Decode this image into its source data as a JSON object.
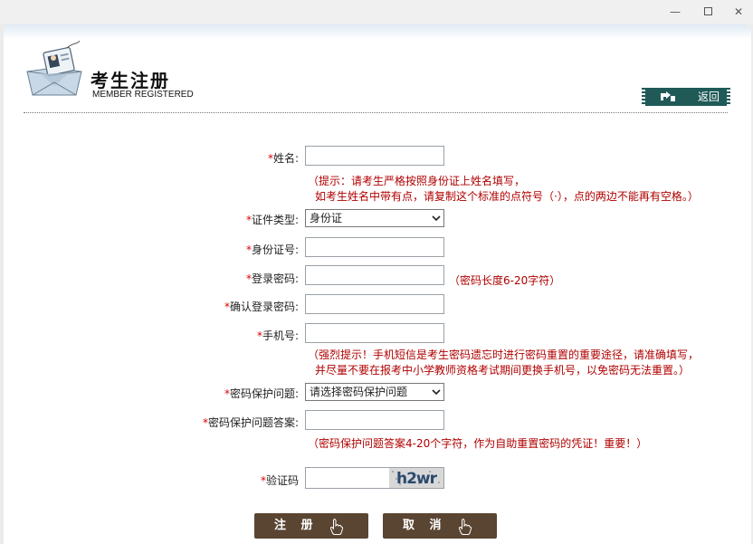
{
  "header": {
    "title": "考生注册",
    "subtitle": "MEMBER REGISTERED",
    "back_label": "返回"
  },
  "form": {
    "name": {
      "label": "姓名:",
      "value": ""
    },
    "name_hint_line1": "（提示：请考生严格按照身份证上姓名填写，",
    "name_hint_line2": "如考生姓名中带有点，请复制这个标准的点符号（·），点的两边不能再有空格。）",
    "id_type": {
      "label": "证件类型:",
      "selected": "身份证"
    },
    "id_number": {
      "label": "身份证号:",
      "value": ""
    },
    "password": {
      "label": "登录密码:",
      "value": "",
      "hint": "（密码长度6-20字符）"
    },
    "confirm_password": {
      "label": "确认登录密码:",
      "value": ""
    },
    "phone": {
      "label": "手机号:",
      "value": ""
    },
    "phone_hint_line1": "（强烈提示！手机短信是考生密码遗忘时进行密码重置的重要途径，请准确填写，",
    "phone_hint_line2": "并尽量不要在报考中小学教师资格考试期间更换手机号，以免密码无法重置。）",
    "security_question": {
      "label": "密码保护问题:",
      "selected": "请选择密码保护问题"
    },
    "security_answer": {
      "label": "密码保护问题答案:",
      "value": "",
      "hint": "（密码保护问题答案4-20个字符，作为自助重置密码的凭证！重要！）"
    },
    "captcha": {
      "label": "验证码",
      "value": "",
      "image_text": "h2wr"
    }
  },
  "buttons": {
    "register": "注 册",
    "cancel": "取 消"
  },
  "required_mark": "*",
  "colors": {
    "required": "#dd0000",
    "hint": "#b00000",
    "back_button": "#1f5a57",
    "action_button": "#5a4532"
  }
}
